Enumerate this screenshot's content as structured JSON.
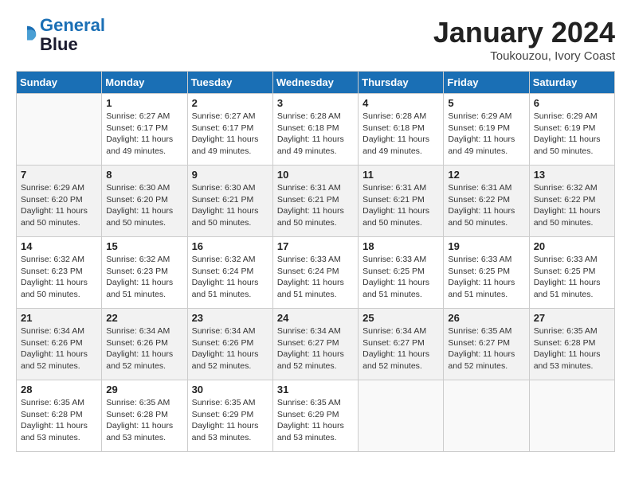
{
  "header": {
    "logo_line1": "General",
    "logo_line2": "Blue",
    "month": "January 2024",
    "location": "Toukouzou, Ivory Coast"
  },
  "days_of_week": [
    "Sunday",
    "Monday",
    "Tuesday",
    "Wednesday",
    "Thursday",
    "Friday",
    "Saturday"
  ],
  "weeks": [
    [
      {
        "day": "",
        "info": ""
      },
      {
        "day": "1",
        "info": "Sunrise: 6:27 AM\nSunset: 6:17 PM\nDaylight: 11 hours\nand 49 minutes."
      },
      {
        "day": "2",
        "info": "Sunrise: 6:27 AM\nSunset: 6:17 PM\nDaylight: 11 hours\nand 49 minutes."
      },
      {
        "day": "3",
        "info": "Sunrise: 6:28 AM\nSunset: 6:18 PM\nDaylight: 11 hours\nand 49 minutes."
      },
      {
        "day": "4",
        "info": "Sunrise: 6:28 AM\nSunset: 6:18 PM\nDaylight: 11 hours\nand 49 minutes."
      },
      {
        "day": "5",
        "info": "Sunrise: 6:29 AM\nSunset: 6:19 PM\nDaylight: 11 hours\nand 49 minutes."
      },
      {
        "day": "6",
        "info": "Sunrise: 6:29 AM\nSunset: 6:19 PM\nDaylight: 11 hours\nand 50 minutes."
      }
    ],
    [
      {
        "day": "7",
        "info": "Sunrise: 6:29 AM\nSunset: 6:20 PM\nDaylight: 11 hours\nand 50 minutes."
      },
      {
        "day": "8",
        "info": "Sunrise: 6:30 AM\nSunset: 6:20 PM\nDaylight: 11 hours\nand 50 minutes."
      },
      {
        "day": "9",
        "info": "Sunrise: 6:30 AM\nSunset: 6:21 PM\nDaylight: 11 hours\nand 50 minutes."
      },
      {
        "day": "10",
        "info": "Sunrise: 6:31 AM\nSunset: 6:21 PM\nDaylight: 11 hours\nand 50 minutes."
      },
      {
        "day": "11",
        "info": "Sunrise: 6:31 AM\nSunset: 6:21 PM\nDaylight: 11 hours\nand 50 minutes."
      },
      {
        "day": "12",
        "info": "Sunrise: 6:31 AM\nSunset: 6:22 PM\nDaylight: 11 hours\nand 50 minutes."
      },
      {
        "day": "13",
        "info": "Sunrise: 6:32 AM\nSunset: 6:22 PM\nDaylight: 11 hours\nand 50 minutes."
      }
    ],
    [
      {
        "day": "14",
        "info": "Sunrise: 6:32 AM\nSunset: 6:23 PM\nDaylight: 11 hours\nand 50 minutes."
      },
      {
        "day": "15",
        "info": "Sunrise: 6:32 AM\nSunset: 6:23 PM\nDaylight: 11 hours\nand 51 minutes."
      },
      {
        "day": "16",
        "info": "Sunrise: 6:32 AM\nSunset: 6:24 PM\nDaylight: 11 hours\nand 51 minutes."
      },
      {
        "day": "17",
        "info": "Sunrise: 6:33 AM\nSunset: 6:24 PM\nDaylight: 11 hours\nand 51 minutes."
      },
      {
        "day": "18",
        "info": "Sunrise: 6:33 AM\nSunset: 6:25 PM\nDaylight: 11 hours\nand 51 minutes."
      },
      {
        "day": "19",
        "info": "Sunrise: 6:33 AM\nSunset: 6:25 PM\nDaylight: 11 hours\nand 51 minutes."
      },
      {
        "day": "20",
        "info": "Sunrise: 6:33 AM\nSunset: 6:25 PM\nDaylight: 11 hours\nand 51 minutes."
      }
    ],
    [
      {
        "day": "21",
        "info": "Sunrise: 6:34 AM\nSunset: 6:26 PM\nDaylight: 11 hours\nand 52 minutes."
      },
      {
        "day": "22",
        "info": "Sunrise: 6:34 AM\nSunset: 6:26 PM\nDaylight: 11 hours\nand 52 minutes."
      },
      {
        "day": "23",
        "info": "Sunrise: 6:34 AM\nSunset: 6:26 PM\nDaylight: 11 hours\nand 52 minutes."
      },
      {
        "day": "24",
        "info": "Sunrise: 6:34 AM\nSunset: 6:27 PM\nDaylight: 11 hours\nand 52 minutes."
      },
      {
        "day": "25",
        "info": "Sunrise: 6:34 AM\nSunset: 6:27 PM\nDaylight: 11 hours\nand 52 minutes."
      },
      {
        "day": "26",
        "info": "Sunrise: 6:35 AM\nSunset: 6:27 PM\nDaylight: 11 hours\nand 52 minutes."
      },
      {
        "day": "27",
        "info": "Sunrise: 6:35 AM\nSunset: 6:28 PM\nDaylight: 11 hours\nand 53 minutes."
      }
    ],
    [
      {
        "day": "28",
        "info": "Sunrise: 6:35 AM\nSunset: 6:28 PM\nDaylight: 11 hours\nand 53 minutes."
      },
      {
        "day": "29",
        "info": "Sunrise: 6:35 AM\nSunset: 6:28 PM\nDaylight: 11 hours\nand 53 minutes."
      },
      {
        "day": "30",
        "info": "Sunrise: 6:35 AM\nSunset: 6:29 PM\nDaylight: 11 hours\nand 53 minutes."
      },
      {
        "day": "31",
        "info": "Sunrise: 6:35 AM\nSunset: 6:29 PM\nDaylight: 11 hours\nand 53 minutes."
      },
      {
        "day": "",
        "info": ""
      },
      {
        "day": "",
        "info": ""
      },
      {
        "day": "",
        "info": ""
      }
    ]
  ]
}
